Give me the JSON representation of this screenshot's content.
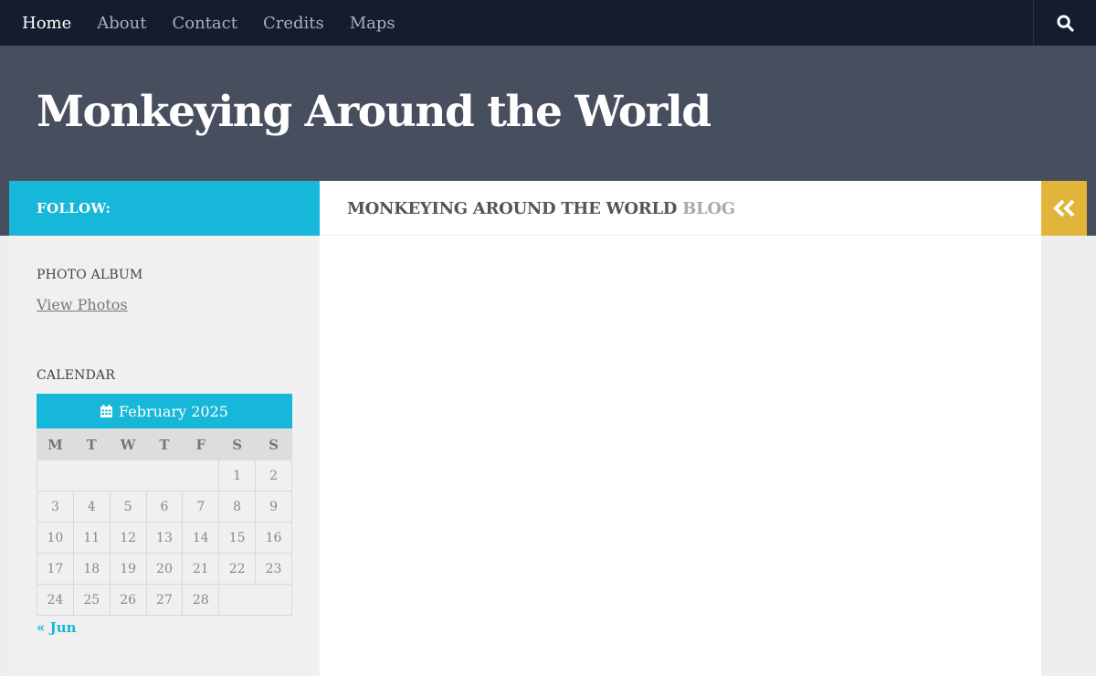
{
  "nav": {
    "items": [
      {
        "label": "Home",
        "active": true
      },
      {
        "label": "About",
        "active": false
      },
      {
        "label": "Contact",
        "active": false
      },
      {
        "label": "Credits",
        "active": false
      },
      {
        "label": "Maps",
        "active": false
      }
    ],
    "search_icon": "search-icon"
  },
  "header": {
    "site_title": "Monkeying Around the World"
  },
  "follow": {
    "label": "FOLLOW:"
  },
  "main": {
    "title_main": "MONKEYING AROUND THE WORLD",
    "title_suffix": "BLOG"
  },
  "toggle": {
    "icon": "double-chevron-left-icon"
  },
  "sidebar": {
    "photo_album": {
      "title": "PHOTO ALBUM",
      "link": "View Photos"
    },
    "calendar": {
      "title": "CALENDAR",
      "caption": "February 2025",
      "caption_icon": "calendar-icon",
      "weekdays": [
        "M",
        "T",
        "W",
        "T",
        "F",
        "S",
        "S"
      ],
      "weeks": [
        [
          "",
          "",
          "",
          "",
          "",
          "1",
          "2"
        ],
        [
          "3",
          "4",
          "5",
          "6",
          "7",
          "8",
          "9"
        ],
        [
          "10",
          "11",
          "12",
          "13",
          "14",
          "15",
          "16"
        ],
        [
          "17",
          "18",
          "19",
          "20",
          "21",
          "22",
          "23"
        ],
        [
          "24",
          "25",
          "26",
          "27",
          "28",
          "",
          ""
        ]
      ],
      "prev_link": "« Jun"
    }
  },
  "colors": {
    "nav_bg": "#141d30",
    "header_bg": "#474f5e",
    "accent": "#16b7d9",
    "toggle": "#e1b43a"
  }
}
